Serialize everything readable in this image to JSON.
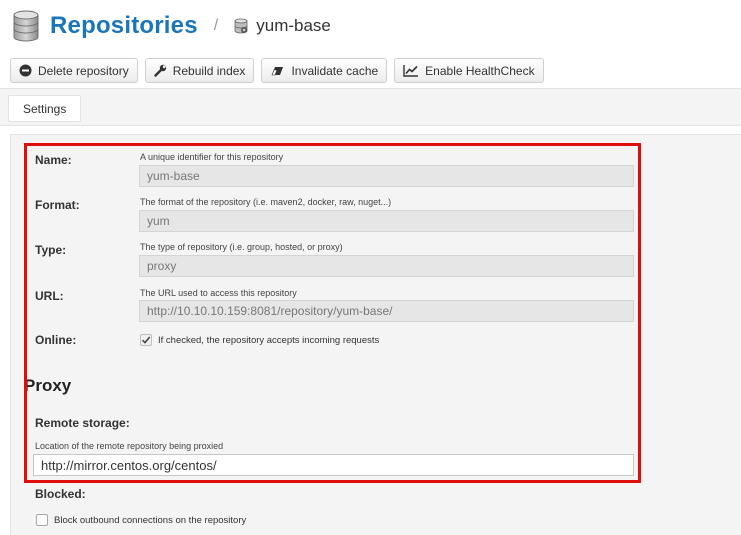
{
  "header": {
    "title": "Repositories",
    "separator": "/",
    "current_repo": "yum-base"
  },
  "toolbar": {
    "delete_label": "Delete repository",
    "rebuild_label": "Rebuild index",
    "invalidate_label": "Invalidate cache",
    "healthcheck_label": "Enable HealthCheck"
  },
  "tabs": {
    "settings_label": "Settings"
  },
  "form": {
    "name": {
      "label": "Name:",
      "hint": "A unique identifier for this repository",
      "value": "yum-base"
    },
    "format": {
      "label": "Format:",
      "hint": "The format of the repository (i.e. maven2, docker, raw, nuget...)",
      "value": "yum"
    },
    "type": {
      "label": "Type:",
      "hint": "The type of repository (i.e. group, hosted, or proxy)",
      "value": "proxy"
    },
    "url": {
      "label": "URL:",
      "hint": "The URL used to access this repository",
      "value": "http://10.10.10.159:8081/repository/yum-base/"
    },
    "online": {
      "label": "Online:",
      "checkbox_text": "If checked, the repository accepts incoming requests",
      "checked": true
    },
    "proxy": {
      "section_title": "Proxy",
      "remote_storage_label": "Remote storage:",
      "remote_storage_hint": "Location of the remote repository being proxied",
      "remote_storage_value": "http://mirror.centos.org/centos/"
    },
    "blocked": {
      "label": "Blocked:",
      "checkbox_text": "Block outbound connections on the repository",
      "checked": false
    }
  },
  "icons": {
    "title_icon": "database-icon",
    "crumb_icon": "database-icon",
    "delete_icon": "minus-circle-icon",
    "rebuild_icon": "wrench-icon",
    "invalidate_icon": "eraser-icon",
    "healthcheck_icon": "line-chart-icon"
  },
  "colors": {
    "title_blue": "#1b75bb",
    "highlight_red": "#e00d0d",
    "panel_bg": "#f4f4f4"
  }
}
